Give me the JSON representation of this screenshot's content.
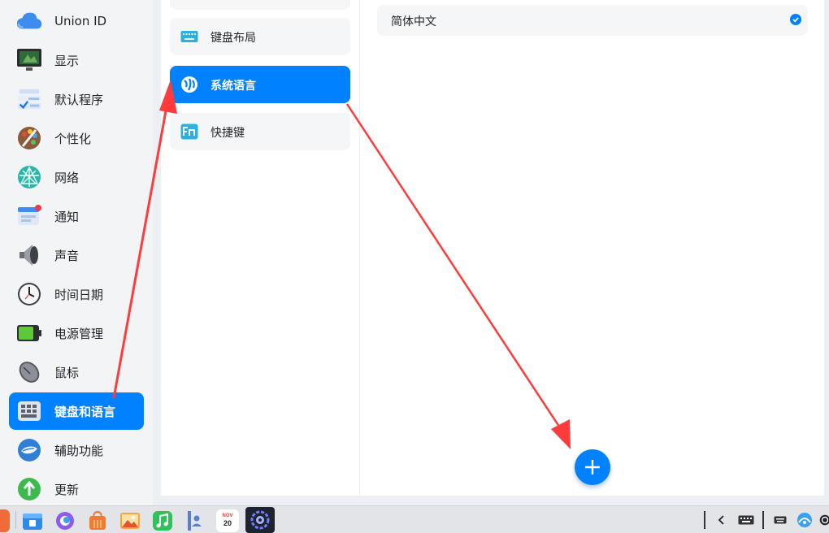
{
  "sidebar": {
    "items": [
      {
        "label": "Union ID",
        "icon": "cloud-icon"
      },
      {
        "label": "显示",
        "icon": "monitor-icon"
      },
      {
        "label": "默认程序",
        "icon": "default-apps-icon"
      },
      {
        "label": "个性化",
        "icon": "palette-icon"
      },
      {
        "label": "网络",
        "icon": "network-icon"
      },
      {
        "label": "通知",
        "icon": "notification-icon"
      },
      {
        "label": "声音",
        "icon": "speaker-icon"
      },
      {
        "label": "时间日期",
        "icon": "clock-icon"
      },
      {
        "label": "电源管理",
        "icon": "battery-icon"
      },
      {
        "label": "鼠标",
        "icon": "mouse-icon"
      },
      {
        "label": "键盘和语言",
        "icon": "keyboard-icon",
        "active": true
      },
      {
        "label": "辅助功能",
        "icon": "accessibility-icon"
      },
      {
        "label": "更新",
        "icon": "update-icon"
      }
    ]
  },
  "subnav": {
    "items": [
      {
        "label": "键盘布局",
        "icon": "keyboard-layout-icon"
      },
      {
        "label": "系统语言",
        "icon": "language-icon",
        "active": true
      },
      {
        "label": "快捷键",
        "icon": "fn-shortcut-icon"
      }
    ]
  },
  "main": {
    "languages": [
      {
        "label": "简体中文",
        "selected": true
      }
    ],
    "add_button_icon": "plus-icon"
  },
  "dock": {
    "calendar_month": "NOV",
    "calendar_day": "20"
  },
  "colors": {
    "accent": "#0081ff",
    "annotation_arrow": "#ff3b3b"
  }
}
